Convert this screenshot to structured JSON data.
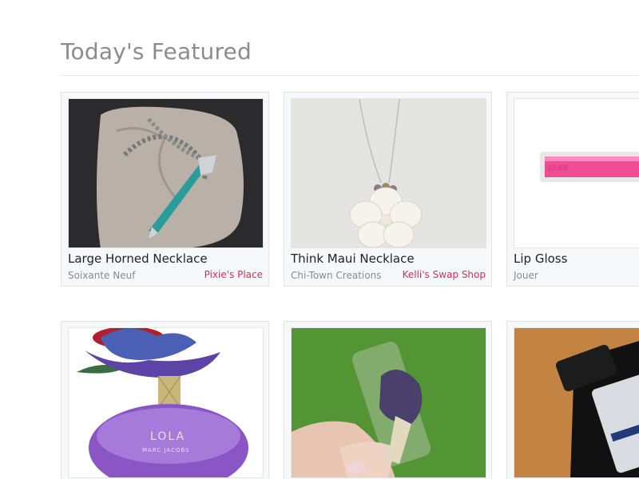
{
  "section": {
    "title": "Today's Featured"
  },
  "products": [
    {
      "name": "Large Horned Necklace",
      "brand": "Soixante Neuf",
      "shop": "Pixie's Place",
      "image_icon": "necklace-horn-photo"
    },
    {
      "name": "Think Maui Necklace",
      "brand": "Chi-Town Creations",
      "shop": "Kelli's Swap Shop",
      "image_icon": "necklace-flower-photo"
    },
    {
      "name": "Lip Gloss",
      "brand": "Jouer",
      "shop": "",
      "image_icon": "lip-gloss-photo"
    },
    {
      "name": "",
      "brand": "",
      "shop": "",
      "image_icon": "perfume-bottle-photo"
    },
    {
      "name": "",
      "brand": "",
      "shop": "",
      "image_icon": "makeup-brush-photo"
    },
    {
      "name": "",
      "brand": "",
      "shop": "",
      "image_icon": "serum-bottle-photo"
    }
  ],
  "colors": {
    "shop_link": "#e4285a",
    "title": "#8c8c8c"
  }
}
